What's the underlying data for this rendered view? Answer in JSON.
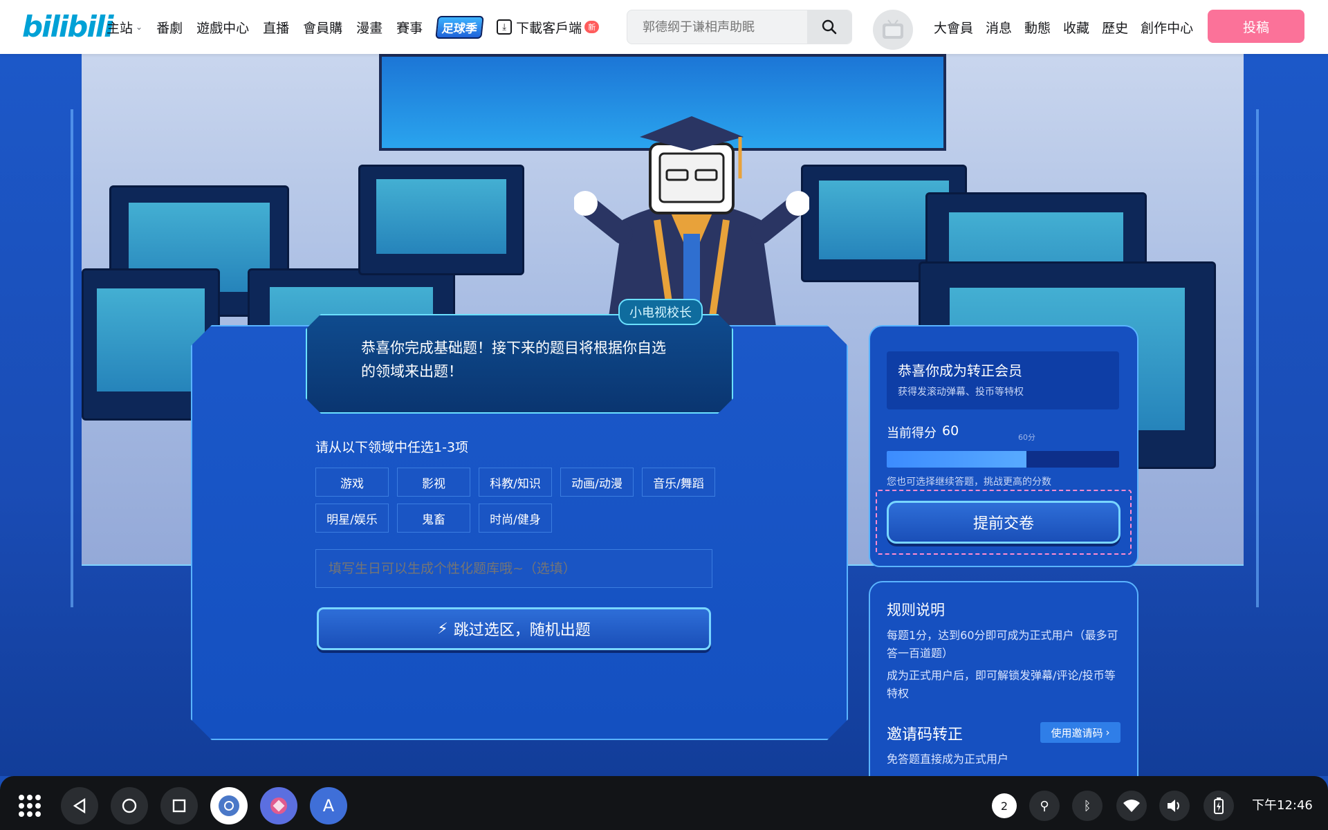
{
  "header": {
    "logo": "bilibili",
    "nav_left": [
      "主站",
      "番劇",
      "遊戲中心",
      "直播",
      "會員購",
      "漫畫",
      "賽事"
    ],
    "sport_badge": "足球季",
    "download": "下載客戶端",
    "new_badge": "新",
    "search_placeholder": "郭德纲于谦相声助眠",
    "nav_right": [
      "大會員",
      "消息",
      "動態",
      "收藏",
      "歷史",
      "創作中心"
    ],
    "upload": "投稿"
  },
  "quiz": {
    "principal": "小电视校长",
    "speech": "恭喜你完成基础题！接下来的题目将根据你自选的领域来出题！",
    "choose_label": "请从以下领域中任选1-3项",
    "categories": [
      "游戏",
      "影视",
      "科教/知识",
      "动画/动漫",
      "音乐/舞蹈",
      "明星/娱乐",
      "鬼畜",
      "时尚/健身"
    ],
    "birthday_placeholder": "填写生日可以生成个性化题库哦~（选填）",
    "skip_button": "跳过选区，随机出题"
  },
  "score": {
    "member_title": "恭喜你成为转正会员",
    "member_sub": "获得发滚动弹幕、投币等特权",
    "label": "当前得分",
    "value": "60",
    "mark": "60分",
    "progress_fraction": 0.6,
    "tip": "您也可选择继续答题，挑战更高的分数",
    "submit": "提前交卷"
  },
  "rules": {
    "title": "规则说明",
    "p1": "每题1分，达到60分即可成为正式用户（最多可答一百道题）",
    "p2": "成为正式用户后，即可解锁发弹幕/评论/投币等特权",
    "invite_title": "邀请码转正",
    "invite_button": "使用邀请码",
    "invite_sub": "免答题直接成为正式用户"
  },
  "taskbar": {
    "tray_count": "2",
    "clock": "下午12:46",
    "app_letter": "A"
  }
}
